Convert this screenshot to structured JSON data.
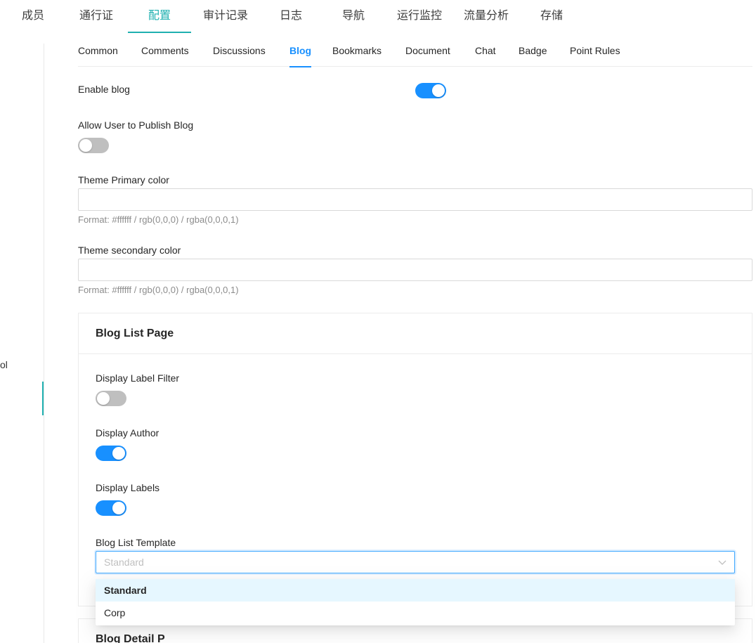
{
  "top_nav": {
    "tabs": [
      "成员",
      "通行证",
      "配置",
      "审计记录",
      "日志",
      "导航",
      "运行监控",
      "流量分析",
      "存储"
    ],
    "active_tab": "配置"
  },
  "sidebar": {
    "partial_label": "ol"
  },
  "sub_tabs": {
    "items": [
      "Common",
      "Comments",
      "Discussions",
      "Blog",
      "Bookmarks",
      "Document",
      "Chat",
      "Badge",
      "Point Rules"
    ],
    "active": "Blog"
  },
  "settings": {
    "enable_blog": {
      "label": "Enable blog",
      "on": true
    },
    "allow_publish": {
      "label": "Allow User to Publish Blog",
      "on": false
    },
    "primary_color": {
      "label": "Theme Primary color",
      "value": "",
      "hint": "Format: #ffffff / rgb(0,0,0) / rgba(0,0,0,1)"
    },
    "secondary_color": {
      "label": "Theme secondary color",
      "value": "",
      "hint": "Format: #ffffff / rgb(0,0,0) / rgba(0,0,0,1)"
    }
  },
  "blog_list_page": {
    "title": "Blog List Page",
    "display_label_filter": {
      "label": "Display Label Filter",
      "on": false
    },
    "display_author": {
      "label": "Display Author",
      "on": true
    },
    "display_labels": {
      "label": "Display Labels",
      "on": true
    },
    "template": {
      "label": "Blog List Template",
      "selected": "Standard",
      "options": [
        "Standard",
        "Corp"
      ]
    }
  },
  "blog_detail_page": {
    "title_partial": "Blog Detail P"
  },
  "colors": {
    "accent_nav": "#1fb0b0",
    "accent_primary": "#1890ff",
    "toggle_off": "#bfbfbf"
  },
  "icons": {
    "select_arrow": "chevron-down-icon"
  }
}
